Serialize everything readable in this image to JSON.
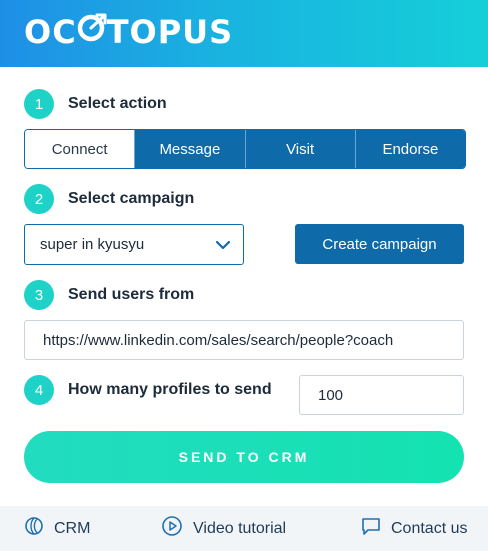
{
  "brand": {
    "logo_text_a": "OC",
    "logo_text_b": "TOPUS",
    "accent": "#0e6aa8",
    "teal": "#1fd2c8"
  },
  "steps": [
    {
      "num": "1",
      "label": "Select action"
    },
    {
      "num": "2",
      "label": "Select campaign"
    },
    {
      "num": "3",
      "label": "Send users from"
    },
    {
      "num": "4",
      "label": "How many profiles to send"
    }
  ],
  "actions": [
    {
      "label": "Connect",
      "active": true
    },
    {
      "label": "Message",
      "active": false
    },
    {
      "label": "Visit",
      "active": false
    },
    {
      "label": "Endorse",
      "active": false
    }
  ],
  "campaign": {
    "selected": "super in kyusyu",
    "create_label": "Create campaign"
  },
  "source": {
    "url": "https://www.linkedin.com/sales/search/people?coach"
  },
  "count": {
    "value": "100"
  },
  "send": {
    "label": "SEND TO CRM"
  },
  "footer": {
    "crm": "CRM",
    "video": "Video tutorial",
    "contact": "Contact us"
  }
}
